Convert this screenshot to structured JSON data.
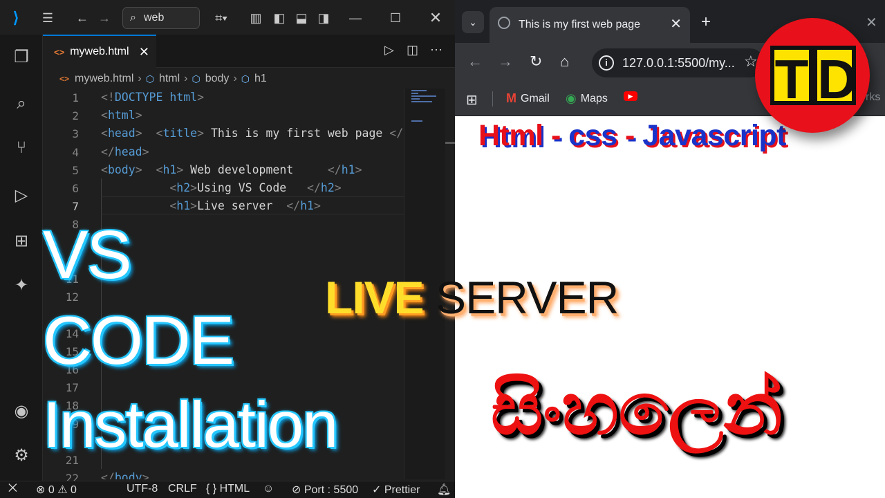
{
  "vscode": {
    "search_label": "web",
    "tab": {
      "icon": "<>",
      "label": "myweb.html"
    },
    "breadcrumb": [
      "myweb.html",
      "html",
      "body",
      "h1"
    ],
    "line_numbers": [
      "1",
      "2",
      "3",
      "4",
      "5",
      "6",
      "7",
      "8",
      "11",
      "12",
      "14",
      "15",
      "16",
      "17",
      "18",
      "19",
      "21",
      "22"
    ],
    "code_lines": [
      {
        "parts": [
          [
            "p",
            "<!"
          ],
          [
            "t",
            "DOCTYPE"
          ],
          [
            "tx",
            " "
          ],
          [
            "t",
            "html"
          ],
          [
            "p",
            ">"
          ]
        ]
      },
      {
        "parts": [
          [
            "p",
            "<"
          ],
          [
            "t",
            "html"
          ],
          [
            "p",
            ">"
          ]
        ]
      },
      {
        "parts": [
          [
            "p",
            "<"
          ],
          [
            "t",
            "head"
          ],
          [
            "p",
            ">"
          ],
          [
            "tx",
            "  "
          ],
          [
            "p",
            "<"
          ],
          [
            "t",
            "title"
          ],
          [
            "p",
            ">"
          ],
          [
            "tx",
            " This is my first web page "
          ],
          [
            "p",
            "</"
          ],
          [
            "t",
            "title"
          ],
          [
            "p",
            ">"
          ]
        ]
      },
      {
        "parts": [
          [
            "p",
            "</"
          ],
          [
            "t",
            "head"
          ],
          [
            "p",
            ">"
          ]
        ]
      },
      {
        "parts": [
          [
            "p",
            "<"
          ],
          [
            "t",
            "body"
          ],
          [
            "p",
            ">"
          ],
          [
            "tx",
            "  "
          ],
          [
            "p",
            "<"
          ],
          [
            "t",
            "h1"
          ],
          [
            "p",
            ">"
          ],
          [
            "tx",
            " Web development     "
          ],
          [
            "p",
            "</"
          ],
          [
            "t",
            "h1"
          ],
          [
            "p",
            ">"
          ]
        ]
      },
      {
        "parts": [
          [
            "tx",
            "          "
          ],
          [
            "p",
            "<"
          ],
          [
            "t",
            "h2"
          ],
          [
            "p",
            ">"
          ],
          [
            "tx",
            "Using VS Code   "
          ],
          [
            "p",
            "</"
          ],
          [
            "t",
            "h2"
          ],
          [
            "p",
            ">"
          ]
        ]
      },
      {
        "parts": [
          [
            "tx",
            "          "
          ],
          [
            "p",
            "<"
          ],
          [
            "t",
            "h1"
          ],
          [
            "p",
            ">"
          ],
          [
            "tx",
            "Live server  "
          ],
          [
            "p",
            "</"
          ],
          [
            "t",
            "h1"
          ],
          [
            "p",
            ">"
          ]
        ]
      },
      {
        "parts": [
          [
            "p",
            "</"
          ],
          [
            "t",
            "body"
          ],
          [
            "p",
            ">"
          ]
        ]
      }
    ],
    "status": {
      "errors": "0",
      "warnings": "0",
      "encoding": "UTF-8",
      "eol": "CRLF",
      "language": "HTML",
      "port": "Port : 5500",
      "formatter": "Prettier"
    }
  },
  "overlay": {
    "line1": "VS",
    "line2": "CODE",
    "line3": "Installation",
    "live": "LIVE",
    "server": "SERVER",
    "subtitle_red1": "Html - ",
    "subtitle_blue1": "css",
    "subtitle_red2": " - ",
    "subtitle_blue2": "Javascript",
    "sinhala": "සිංහලෙන්",
    "logo_t": "T",
    "logo_d": "D"
  },
  "browser": {
    "tab_title": "This is my first web page",
    "url": "127.0.0.1:5500/my...",
    "bookmarks": [
      "Gmail",
      "Maps"
    ],
    "bookmark_fragment": "rks"
  }
}
